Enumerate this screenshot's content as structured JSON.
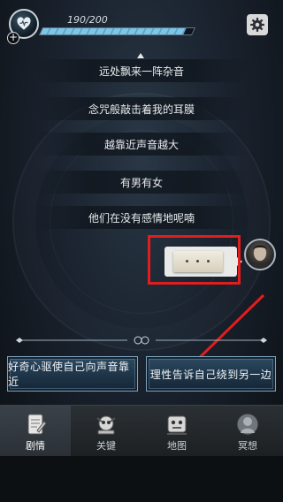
{
  "status": {
    "hp_text": "190/200",
    "hp_fraction": 0.95,
    "heart_icon": "heart-icon",
    "add_icon": "plus-icon",
    "settings_icon": "gear-icon"
  },
  "story": {
    "lines": [
      "远处飘来一阵杂音",
      "念咒般敲击着我的耳膜",
      "越靠近声音越大",
      "有男有女",
      "他们在没有感情地呢喃"
    ],
    "message": {
      "type": "image",
      "image_icon": "device-icon",
      "sender_avatar": "avatar-icon",
      "highlight_color": "#e21d1d"
    }
  },
  "choices": [
    "好奇心驱使自己向声音靠近",
    "理性告诉自己绕到另一边"
  ],
  "annotation": {
    "arrow_color": "#e21d1d"
  },
  "nav": {
    "items": [
      {
        "label": "剧情",
        "icon": "story-icon",
        "active": true
      },
      {
        "label": "关键",
        "icon": "key-icon",
        "active": false
      },
      {
        "label": "地图",
        "icon": "map-icon",
        "active": false
      },
      {
        "label": "冥想",
        "icon": "meditate-icon",
        "active": false
      }
    ]
  },
  "colors": {
    "accent": "#7ec6e6",
    "button_border": "#7da2bf",
    "highlight": "#e21d1d"
  }
}
